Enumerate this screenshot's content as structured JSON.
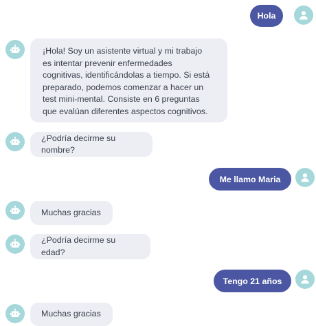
{
  "messages": [
    {
      "sender": "user",
      "text": "Hola"
    },
    {
      "sender": "bot",
      "text": "¡Hola! Soy un asistente virtual y mi trabajo\nes intentar prevenir enfermedades\ncognitivas, identificándolas a tiempo. Si está\npreparado, podemos comenzar a hacer un\ntest mini-mental. Consiste en 6 preguntas\nque evalúan diferentes aspectos cognitivos."
    },
    {
      "sender": "bot",
      "text": "¿Podría decirme su nombre?"
    },
    {
      "sender": "user",
      "text": "Me llamo Maria"
    },
    {
      "sender": "bot",
      "text": "Muchas gracias"
    },
    {
      "sender": "bot",
      "text": "¿Podría decirme su edad?"
    },
    {
      "sender": "user",
      "text": "Tengo 21 años"
    },
    {
      "sender": "bot",
      "text": "Muchas gracias"
    }
  ],
  "colors": {
    "user_bubble": "#4b57a3",
    "bot_bubble": "#eceef4",
    "avatar": "#a6d8db"
  },
  "icons": {
    "user_avatar": "user-icon",
    "bot_avatar": "robot-icon"
  }
}
